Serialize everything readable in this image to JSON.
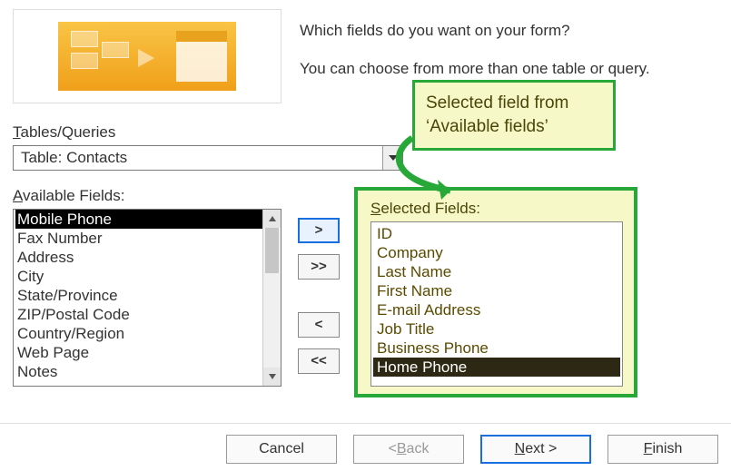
{
  "intro": {
    "question": "Which fields do you want on your form?",
    "hint": "You can choose from more than one table or query."
  },
  "labels": {
    "tables_queries": "Tables/Queries",
    "available_fields": "Available Fields:",
    "selected_fields": "Selected Fields:"
  },
  "combo": {
    "selected": "Table: Contacts"
  },
  "available": {
    "items": [
      "Mobile Phone",
      "Fax Number",
      "Address",
      "City",
      "State/Province",
      "ZIP/Postal Code",
      "Country/Region",
      "Web Page",
      "Notes"
    ],
    "selected_index": 0
  },
  "move_buttons": {
    "add_one": ">",
    "add_all": ">>",
    "remove_one": "<",
    "remove_all": "<<"
  },
  "selected": {
    "items": [
      "ID",
      "Company",
      "Last Name",
      "First Name",
      "E-mail Address",
      "Job Title",
      "Business Phone",
      "Home Phone"
    ],
    "selected_index": 7
  },
  "callout": {
    "line1": "Selected field from",
    "line2": "‘Available fields’"
  },
  "footer": {
    "cancel": "Cancel",
    "back_prefix": "< ",
    "back_u": "B",
    "back_rest": "ack",
    "next_u": "N",
    "next_rest": "ext >",
    "finish_u": "F",
    "finish_rest": "inish"
  }
}
